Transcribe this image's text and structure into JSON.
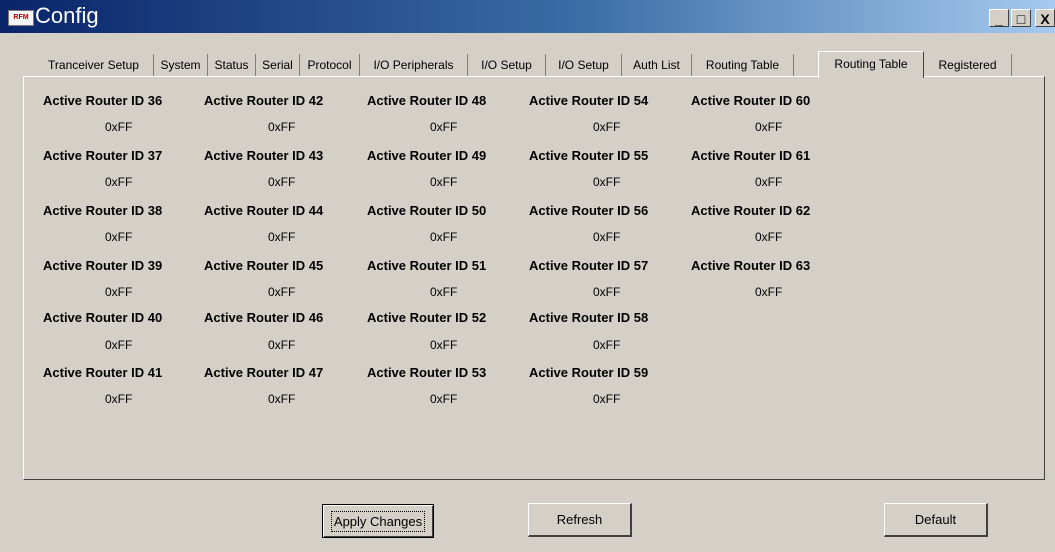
{
  "window": {
    "title": "Config",
    "icon_text": "RFM",
    "min": "_",
    "max": "□",
    "close": "X"
  },
  "tabs": [
    "Tranceiver Setup",
    "System",
    "Status",
    "Serial",
    "Protocol",
    "I/O Peripherals",
    "I/O Setup",
    "I/O Setup",
    "Auth List",
    "Routing Table",
    "Routing Table",
    "Registered"
  ],
  "active_tab": "Routing Table",
  "routers": {
    "col1": [
      {
        "label": "Active Router ID 36",
        "value": "0xFF"
      },
      {
        "label": "Active Router ID 37",
        "value": "0xFF"
      },
      {
        "label": "Active Router ID 38",
        "value": "0xFF"
      },
      {
        "label": "Active Router ID 39",
        "value": "0xFF"
      },
      {
        "label": "Active Router ID 40",
        "value": "0xFF"
      },
      {
        "label": "Active Router ID 41",
        "value": "0xFF"
      }
    ],
    "col2": [
      {
        "label": "Active Router ID 42",
        "value": "0xFF"
      },
      {
        "label": "Active Router ID 43",
        "value": "0xFF"
      },
      {
        "label": "Active Router ID 44",
        "value": "0xFF"
      },
      {
        "label": "Active Router ID 45",
        "value": "0xFF"
      },
      {
        "label": "Active Router ID 46",
        "value": "0xFF"
      },
      {
        "label": "Active Router ID 47",
        "value": "0xFF"
      }
    ],
    "col3": [
      {
        "label": "Active Router ID 48",
        "value": "0xFF"
      },
      {
        "label": "Active Router ID 49",
        "value": "0xFF"
      },
      {
        "label": "Active Router ID 50",
        "value": "0xFF"
      },
      {
        "label": "Active Router ID 51",
        "value": "0xFF"
      },
      {
        "label": "Active Router ID 52",
        "value": "0xFF"
      },
      {
        "label": "Active Router ID 53",
        "value": "0xFF"
      }
    ],
    "col4": [
      {
        "label": "Active Router ID 54",
        "value": "0xFF"
      },
      {
        "label": "Active Router ID 55",
        "value": "0xFF"
      },
      {
        "label": "Active Router ID 56",
        "value": "0xFF"
      },
      {
        "label": "Active Router ID 57",
        "value": "0xFF"
      },
      {
        "label": "Active Router ID 58",
        "value": "0xFF"
      },
      {
        "label": "Active Router ID 59",
        "value": "0xFF"
      }
    ],
    "col5": [
      {
        "label": "Active Router ID 60",
        "value": "0xFF"
      },
      {
        "label": "Active Router ID 61",
        "value": "0xFF"
      },
      {
        "label": "Active Router ID 62",
        "value": "0xFF"
      },
      {
        "label": "Active Router ID 63",
        "value": "0xFF"
      }
    ]
  },
  "buttons": {
    "apply": "Apply Changes",
    "refresh": "Refresh",
    "default": "Default"
  }
}
